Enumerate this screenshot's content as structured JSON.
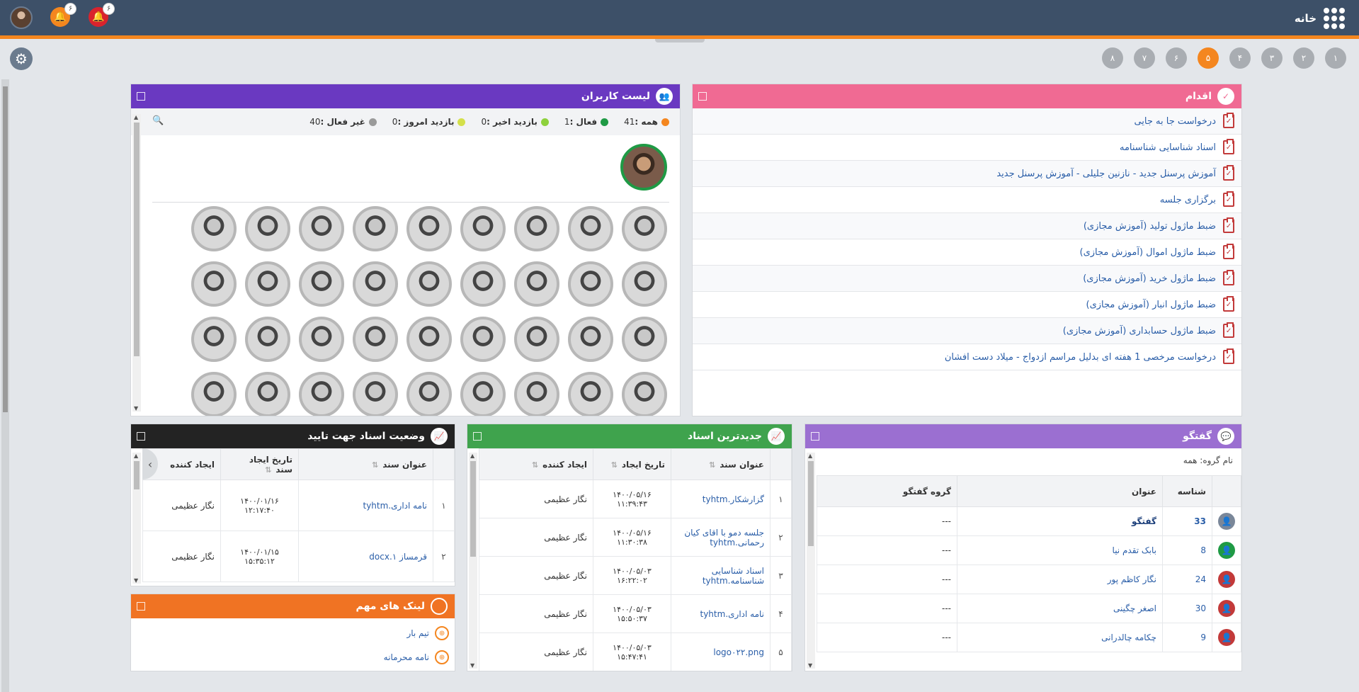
{
  "topbar": {
    "home_label": "خانه",
    "bell1_count": "۶",
    "bell2_count": "۶"
  },
  "colors": {
    "topbar": "#3d5068",
    "accent": "#f4861f",
    "action": "#f06a93",
    "users": "#6a39c1",
    "chat": "#9b6fd1",
    "latest": "#3fa34d",
    "status": "#232323",
    "links": "#f07323"
  },
  "pages": [
    {
      "label": "۱",
      "active": false
    },
    {
      "label": "۲",
      "active": false
    },
    {
      "label": "۳",
      "active": false
    },
    {
      "label": "۴",
      "active": false
    },
    {
      "label": "۵",
      "active": true
    },
    {
      "label": "۶",
      "active": false
    },
    {
      "label": "۷",
      "active": false
    },
    {
      "label": "۸",
      "active": false
    }
  ],
  "actions": {
    "title": "اقدام",
    "items": [
      "درخواست جا به جایی",
      "اسناد شناسایی شناسنامه",
      "آموزش پرسنل جدید - نازنین جلیلی - آموزش پرسنل جدید",
      "برگزاری جلسه",
      "ضبط ماژول تولید (آموزش مجازی)",
      "ضبط ماژول اموال (آموزش مجازی)",
      "ضبط ماژول خرید (آموزش مجازی)",
      "ضبط ماژول انبار (آموزش مجازی)",
      "ضبط ماژول حسابداری (آموزش مجازی)",
      "درخواست مرخصی 1 هفته ای بدلیل مراسم ازدواج - میلاد دست افشان"
    ]
  },
  "users": {
    "title": "لیست کاربران",
    "filters": [
      {
        "label": "همه :",
        "value": "41",
        "color": "#f4861f"
      },
      {
        "label": "فعال :",
        "value": "1",
        "color": "#1f9a45"
      },
      {
        "label": "بازدید اخیر :",
        "value": "0",
        "color": "#8ed13c"
      },
      {
        "label": "بازدید امروز :",
        "value": "0",
        "color": "#d4e04a"
      },
      {
        "label": "غیر فعال :",
        "value": "40",
        "color": "#9a9a9a"
      }
    ],
    "avatar_count": 36
  },
  "chat": {
    "title": "گفتگو",
    "group_label": "نام گروه: همه",
    "columns": [
      "شناسه",
      "عنوان",
      "گروه گفتگو"
    ],
    "rows": [
      {
        "id": "33",
        "title": "گفتگو",
        "group": "---",
        "color": "#7a8799",
        "bold": true
      },
      {
        "id": "8",
        "title": "بابک تقدم نیا",
        "group": "---",
        "color": "#1f9a45",
        "bold": false
      },
      {
        "id": "24",
        "title": "نگار کاظم پور",
        "group": "---",
        "color": "#c23a3a",
        "bold": false
      },
      {
        "id": "30",
        "title": "اصغر چگینی",
        "group": "---",
        "color": "#c23a3a",
        "bold": false
      },
      {
        "id": "9",
        "title": "چکامه چالدرانی",
        "group": "---",
        "color": "#c23a3a",
        "bold": false
      }
    ]
  },
  "latest_docs": {
    "title": "جدیدترین اسناد",
    "columns": [
      "عنوان سند",
      "تاریخ ایجاد",
      "ایجاد کننده"
    ],
    "rows": [
      {
        "n": "۱",
        "title": "گزارشکار.tyhtm",
        "date": "۱۴۰۰/۰۵/۱۶ ۱۱:۳۹:۴۳",
        "creator": "نگار عظیمی"
      },
      {
        "n": "۲",
        "title": "جلسه دمو با اقای کیان رحمانی.tyhtm",
        "date": "۱۴۰۰/۰۵/۱۶ ۱۱:۳۰:۳۸",
        "creator": "نگار عظیمی"
      },
      {
        "n": "۳",
        "title": "اسناد شناسایی شناسنامه.tyhtm",
        "date": "۱۴۰۰/۰۵/۰۳ ۱۶:۲۲:۰۲",
        "creator": "نگار عظیمی"
      },
      {
        "n": "۴",
        "title": "نامه اداری.tyhtm",
        "date": "۱۴۰۰/۰۵/۰۳ ۱۵:۵۰:۳۷",
        "creator": "نگار عظیمی"
      },
      {
        "n": "۵",
        "title": "logo۰۲۲.png",
        "date": "۱۴۰۰/۰۵/۰۳ ۱۵:۴۷:۴۱",
        "creator": "نگار عظیمی"
      }
    ]
  },
  "status_docs": {
    "title": "وضعیت اسناد جهت تایید",
    "columns": [
      "عنوان سند",
      "تاریخ ایجاد سند",
      "ایجاد کننده"
    ],
    "rows": [
      {
        "n": "۱",
        "title": "نامه اداری.tyhtm",
        "date": "۱۴۰۰/۰۱/۱۶ ۱۲:۱۷:۴۰",
        "creator": "نگار عظیمی"
      },
      {
        "n": "۲",
        "title": "قرمساز ۱.docx",
        "date": "۱۴۰۰/۰۱/۱۵ ۱۵:۳۵:۱۲",
        "creator": "نگار عظیمی"
      }
    ]
  },
  "links": {
    "title": "لینک های مهم",
    "items": [
      "تیم بار",
      "نامه محرمانه"
    ]
  }
}
